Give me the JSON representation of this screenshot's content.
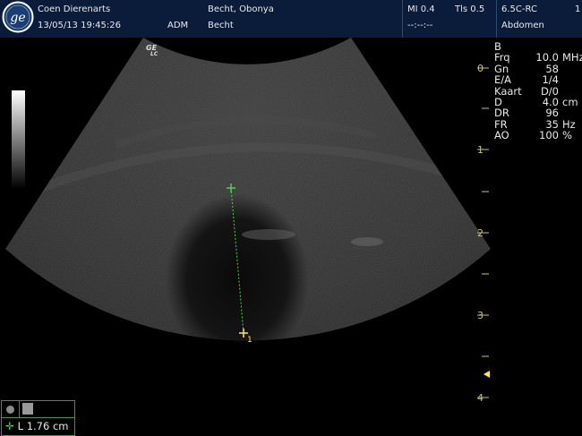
{
  "header": {
    "operator": "Coen Dierenarts",
    "datetime": "13/05/13 19:45:26",
    "user": "ADM",
    "patient_name": "Becht, Obonya",
    "patient_id": "Becht",
    "mi": "MI 0.4",
    "tis": "Tls 0.5",
    "probe": "6.5C-RC",
    "preset": "Abdomen",
    "clip_time": "--:--:--",
    "page": "1"
  },
  "mode": "B",
  "params": [
    {
      "label": "Frq",
      "value": "10.0",
      "unit": "MHz"
    },
    {
      "label": "Gn",
      "value": "58",
      "unit": ""
    },
    {
      "label": "E/A",
      "value": "1/4",
      "unit": ""
    },
    {
      "label": "Kaart",
      "value": "D/0",
      "unit": ""
    },
    {
      "label": "D",
      "value": "4.0",
      "unit": "cm"
    },
    {
      "label": "DR",
      "value": "96",
      "unit": ""
    },
    {
      "label": "FR",
      "value": "35",
      "unit": "Hz"
    },
    {
      "label": "AO",
      "value": "100",
      "unit": "%"
    }
  ],
  "depth_scale": [
    "0",
    "1",
    "2",
    "3",
    "4"
  ],
  "probe_badge": {
    "line1": "GE",
    "line2": "LC"
  },
  "measurement": {
    "marker": "1",
    "label": "L",
    "value": "1.76",
    "unit": "cm",
    "text": "L  1.76 cm"
  },
  "colors": {
    "header_bg": "#0b1c3a",
    "caliper": "#4cd24c",
    "caliper_end": "#ffee33",
    "depth_marks": "#c9c36a"
  }
}
